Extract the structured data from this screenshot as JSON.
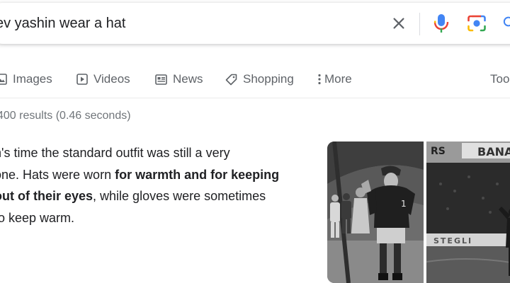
{
  "search": {
    "query": "ev yashin wear a hat"
  },
  "tabs": [
    {
      "label": "Images",
      "icon": "image-icon"
    },
    {
      "label": "Videos",
      "icon": "play-icon"
    },
    {
      "label": "News",
      "icon": "news-icon"
    },
    {
      "label": "Shopping",
      "icon": "tag-icon"
    },
    {
      "label": "More",
      "icon": "more-vertical-icon"
    },
    {
      "label": "Too"
    }
  ],
  "results": {
    "stats": "400 results (0.46 seconds)"
  },
  "snippet": {
    "line1": "n's time the standard outfit was still a very",
    "line2_prefix": "one. Hats were worn ",
    "line2_bold": "for warmth and for keeping",
    "line3_bold": "out of their eyes",
    "line3_suffix": ", while gloves were sometimes",
    "line4": " to keep warm."
  },
  "images": {
    "icons": [
      "soccer-goalkeeper-photo",
      "stadium-photo"
    ]
  },
  "colors": {
    "mic_blue": "#4285f4",
    "mic_red": "#ea4335",
    "mic_yellow": "#fbbc04",
    "mic_green": "#34a853",
    "muted_text": "#70757a",
    "tab_text": "#5f6368"
  }
}
